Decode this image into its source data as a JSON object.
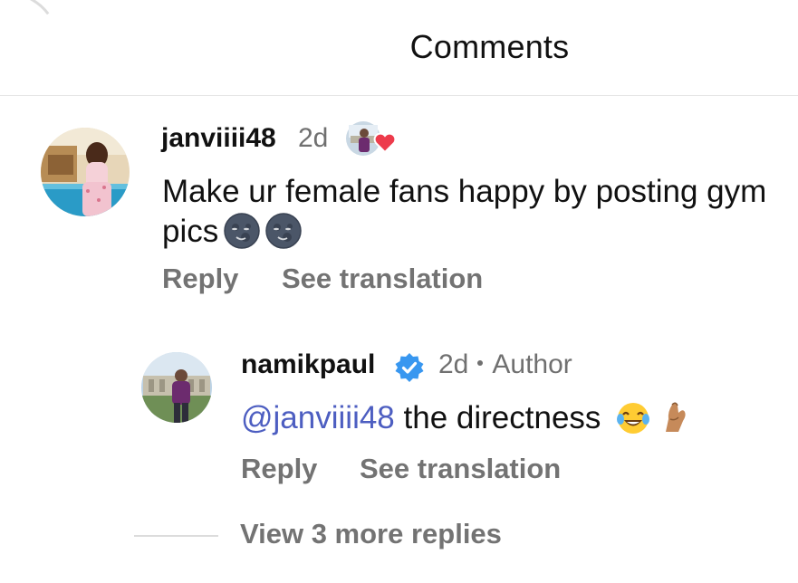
{
  "header": {
    "title": "Comments"
  },
  "comments": [
    {
      "username": "janviiii48",
      "time": "2d",
      "liked_by_author": true,
      "text": "Make ur female fans happy by posting gym pics",
      "emojis": [
        "new-moon-face",
        "new-moon-face"
      ],
      "actions": {
        "reply": "Reply",
        "translate": "See translation"
      }
    }
  ],
  "reply": {
    "username": "namikpaul",
    "verified": true,
    "time": "2d",
    "badge": "Author",
    "mention": "@janviiii48",
    "text": "the directness",
    "emojis": [
      "face-with-tears-of-joy",
      "pinched-fingers"
    ],
    "actions": {
      "reply": "Reply",
      "translate": "See translation"
    }
  },
  "view_more": "View 3 more replies",
  "colors": {
    "mention": "#4d5ec1",
    "verified": "#3897f0",
    "heart": "#ed3b4b",
    "secondary_text": "#737373"
  }
}
